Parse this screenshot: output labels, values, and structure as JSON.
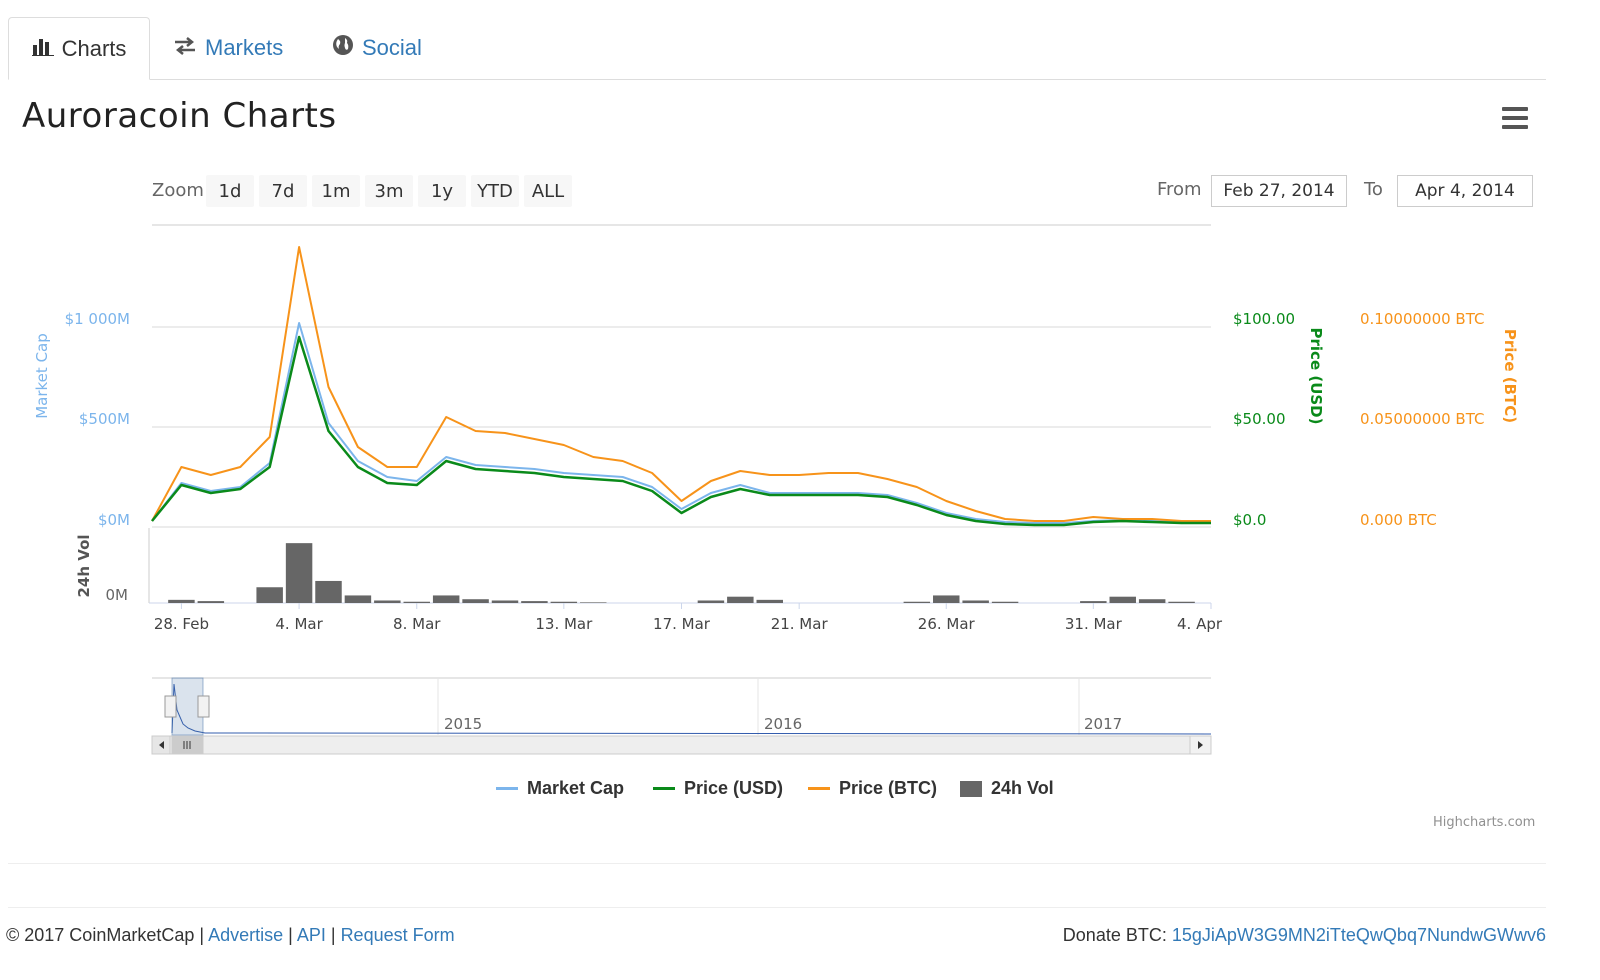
{
  "tabs": [
    {
      "label": "Charts",
      "icon": "bar-chart-icon",
      "active": true
    },
    {
      "label": "Markets",
      "icon": "exchange-arrows-icon",
      "active": false
    },
    {
      "label": "Social",
      "icon": "globe-icon",
      "active": false
    }
  ],
  "title": "Auroracoin Charts",
  "menu_icon": "hamburger-menu-icon",
  "range_selector": {
    "zoom_label": "Zoom",
    "buttons": [
      "1d",
      "7d",
      "1m",
      "3m",
      "1y",
      "YTD",
      "ALL"
    ],
    "from_label": "From",
    "from_value": "Feb 27, 2014",
    "to_label": "To",
    "to_value": "Apr 4, 2014"
  },
  "chart_data": {
    "type": "line",
    "title": "Auroracoin Charts",
    "x_start": "2014-02-27",
    "x_end": "2014-04-04",
    "x_tick_labels": [
      "28. Feb",
      "4. Mar",
      "8. Mar",
      "13. Mar",
      "17. Mar",
      "21. Mar",
      "26. Mar",
      "31. Mar",
      "4. Apr"
    ],
    "y_axes": {
      "market_cap": {
        "title": "Market Cap",
        "ticks": [
          "$0M",
          "$500M",
          "$1 000M"
        ],
        "range": [
          0,
          1000
        ],
        "unit": "M USD",
        "color": "#7cb5ec"
      },
      "price_usd": {
        "title": "Price (USD)",
        "ticks": [
          "$0.0",
          "$50.00",
          "$100.00"
        ],
        "range": [
          0,
          100
        ],
        "color": "#0a8a1a"
      },
      "price_btc": {
        "title": "Price (BTC)",
        "ticks": [
          "0.000 BTC",
          "0.05000000 BTC",
          "0.10000000 BTC"
        ],
        "range": [
          0,
          0.1
        ],
        "color": "#f7931a"
      },
      "volume": {
        "title": "24h Vol",
        "ticks": [
          "0M"
        ]
      }
    },
    "series": [
      {
        "name": "Market Cap",
        "color": "#7cb5ec",
        "x": [
          "2014-02-27",
          "2014-02-28",
          "2014-03-01",
          "2014-03-02",
          "2014-03-03",
          "2014-03-04",
          "2014-03-05",
          "2014-03-06",
          "2014-03-07",
          "2014-03-08",
          "2014-03-09",
          "2014-03-10",
          "2014-03-11",
          "2014-03-12",
          "2014-03-13",
          "2014-03-14",
          "2014-03-15",
          "2014-03-16",
          "2014-03-17",
          "2014-03-18",
          "2014-03-19",
          "2014-03-20",
          "2014-03-21",
          "2014-03-22",
          "2014-03-23",
          "2014-03-24",
          "2014-03-25",
          "2014-03-26",
          "2014-03-27",
          "2014-03-28",
          "2014-03-29",
          "2014-03-30",
          "2014-03-31",
          "2014-04-01",
          "2014-04-02",
          "2014-04-03",
          "2014-04-04"
        ],
        "values": [
          30,
          220,
          180,
          200,
          320,
          1020,
          520,
          330,
          250,
          230,
          350,
          310,
          300,
          290,
          270,
          260,
          250,
          200,
          90,
          170,
          210,
          170,
          170,
          170,
          170,
          160,
          120,
          70,
          40,
          25,
          20,
          20,
          30,
          35,
          30,
          25,
          25
        ]
      },
      {
        "name": "Price (USD)",
        "color": "#0a8a1a",
        "x": [
          "2014-02-27",
          "2014-02-28",
          "2014-03-01",
          "2014-03-02",
          "2014-03-03",
          "2014-03-04",
          "2014-03-05",
          "2014-03-06",
          "2014-03-07",
          "2014-03-08",
          "2014-03-09",
          "2014-03-10",
          "2014-03-11",
          "2014-03-12",
          "2014-03-13",
          "2014-03-14",
          "2014-03-15",
          "2014-03-16",
          "2014-03-17",
          "2014-03-18",
          "2014-03-19",
          "2014-03-20",
          "2014-03-21",
          "2014-03-22",
          "2014-03-23",
          "2014-03-24",
          "2014-03-25",
          "2014-03-26",
          "2014-03-27",
          "2014-03-28",
          "2014-03-29",
          "2014-03-30",
          "2014-03-31",
          "2014-04-01",
          "2014-04-02",
          "2014-04-03",
          "2014-04-04"
        ],
        "values": [
          3,
          21,
          17,
          19,
          30,
          95,
          48,
          30,
          22,
          21,
          33,
          29,
          28,
          27,
          25,
          24,
          23,
          18,
          7,
          15,
          19,
          16,
          16,
          16,
          16,
          15,
          11,
          6,
          3,
          1.5,
          1,
          1,
          2.5,
          3,
          2.5,
          2,
          2
        ]
      },
      {
        "name": "Price (BTC)",
        "color": "#f7931a",
        "x": [
          "2014-02-27",
          "2014-02-28",
          "2014-03-01",
          "2014-03-02",
          "2014-03-03",
          "2014-03-04",
          "2014-03-05",
          "2014-03-06",
          "2014-03-07",
          "2014-03-08",
          "2014-03-09",
          "2014-03-10",
          "2014-03-11",
          "2014-03-12",
          "2014-03-13",
          "2014-03-14",
          "2014-03-15",
          "2014-03-16",
          "2014-03-17",
          "2014-03-18",
          "2014-03-19",
          "2014-03-20",
          "2014-03-21",
          "2014-03-22",
          "2014-03-23",
          "2014-03-24",
          "2014-03-25",
          "2014-03-26",
          "2014-03-27",
          "2014-03-28",
          "2014-03-29",
          "2014-03-30",
          "2014-03-31",
          "2014-04-01",
          "2014-04-02",
          "2014-04-03",
          "2014-04-04"
        ],
        "values": [
          0.003,
          0.03,
          0.026,
          0.03,
          0.045,
          0.14,
          0.07,
          0.04,
          0.03,
          0.03,
          0.055,
          0.048,
          0.047,
          0.044,
          0.041,
          0.035,
          0.033,
          0.027,
          0.013,
          0.023,
          0.028,
          0.026,
          0.026,
          0.027,
          0.027,
          0.024,
          0.02,
          0.013,
          0.008,
          0.004,
          0.003,
          0.003,
          0.005,
          0.004,
          0.004,
          0.003,
          0.003
        ]
      },
      {
        "name": "24h Vol",
        "color": "#666666",
        "x": [
          "2014-02-27",
          "2014-02-28",
          "2014-03-01",
          "2014-03-02",
          "2014-03-03",
          "2014-03-04",
          "2014-03-05",
          "2014-03-06",
          "2014-03-07",
          "2014-03-08",
          "2014-03-09",
          "2014-03-10",
          "2014-03-11",
          "2014-03-12",
          "2014-03-13",
          "2014-03-14",
          "2014-03-15",
          "2014-03-16",
          "2014-03-17",
          "2014-03-18",
          "2014-03-19",
          "2014-03-20",
          "2014-03-21",
          "2014-03-22",
          "2014-03-23",
          "2014-03-24",
          "2014-03-25",
          "2014-03-26",
          "2014-03-27",
          "2014-03-28",
          "2014-03-29",
          "2014-03-30",
          "2014-03-31",
          "2014-04-01",
          "2014-04-02",
          "2014-04-03",
          "2014-04-04"
        ],
        "values": [
          0,
          0.05,
          0.03,
          0,
          0.25,
          0.95,
          0.35,
          0.12,
          0.04,
          0.02,
          0.12,
          0.06,
          0.04,
          0.03,
          0.02,
          0.01,
          0,
          0,
          0,
          0.04,
          0.1,
          0.05,
          0,
          0,
          0,
          0,
          0.02,
          0.12,
          0.04,
          0.02,
          0,
          0,
          0.03,
          0.1,
          0.06,
          0.02,
          0
        ]
      }
    ],
    "legend": [
      "Market Cap",
      "Price (USD)",
      "Price (BTC)",
      "24h Vol"
    ],
    "legend_placement": "bottom-center",
    "navigator": {
      "year_labels": [
        "2015",
        "2016",
        "2017"
      ]
    },
    "credits": "Highcharts.com"
  },
  "footer": {
    "copyright": "© 2017 CoinMarketCap |",
    "links": [
      "Advertise",
      "API",
      "Request Form"
    ],
    "separator": "|",
    "donate_label": "Donate BTC:",
    "donate_address": "15gJiApW3G9MN2iTteQwQbq7NundwGWwv6"
  }
}
